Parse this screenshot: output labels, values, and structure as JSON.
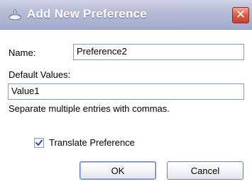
{
  "dialog": {
    "title": "Add New Preference",
    "title_icon": "add-preference-icon",
    "close_icon": "close-icon",
    "close_glyph": "✕"
  },
  "form": {
    "name_label": "Name:",
    "name_value": "Preference2",
    "default_values_label": "Default Values:",
    "default_values_value": "Value1",
    "hint": "Separate multiple entries with commas.",
    "translate_label": "Translate Preference",
    "translate_checked": true
  },
  "buttons": {
    "ok_label": "OK",
    "cancel_label": "Cancel"
  },
  "colors": {
    "titlebar": "#b7bcd7",
    "close_button": "#d9604a",
    "field_border": "#7f9db9",
    "checkmark": "#2a4fa0"
  }
}
